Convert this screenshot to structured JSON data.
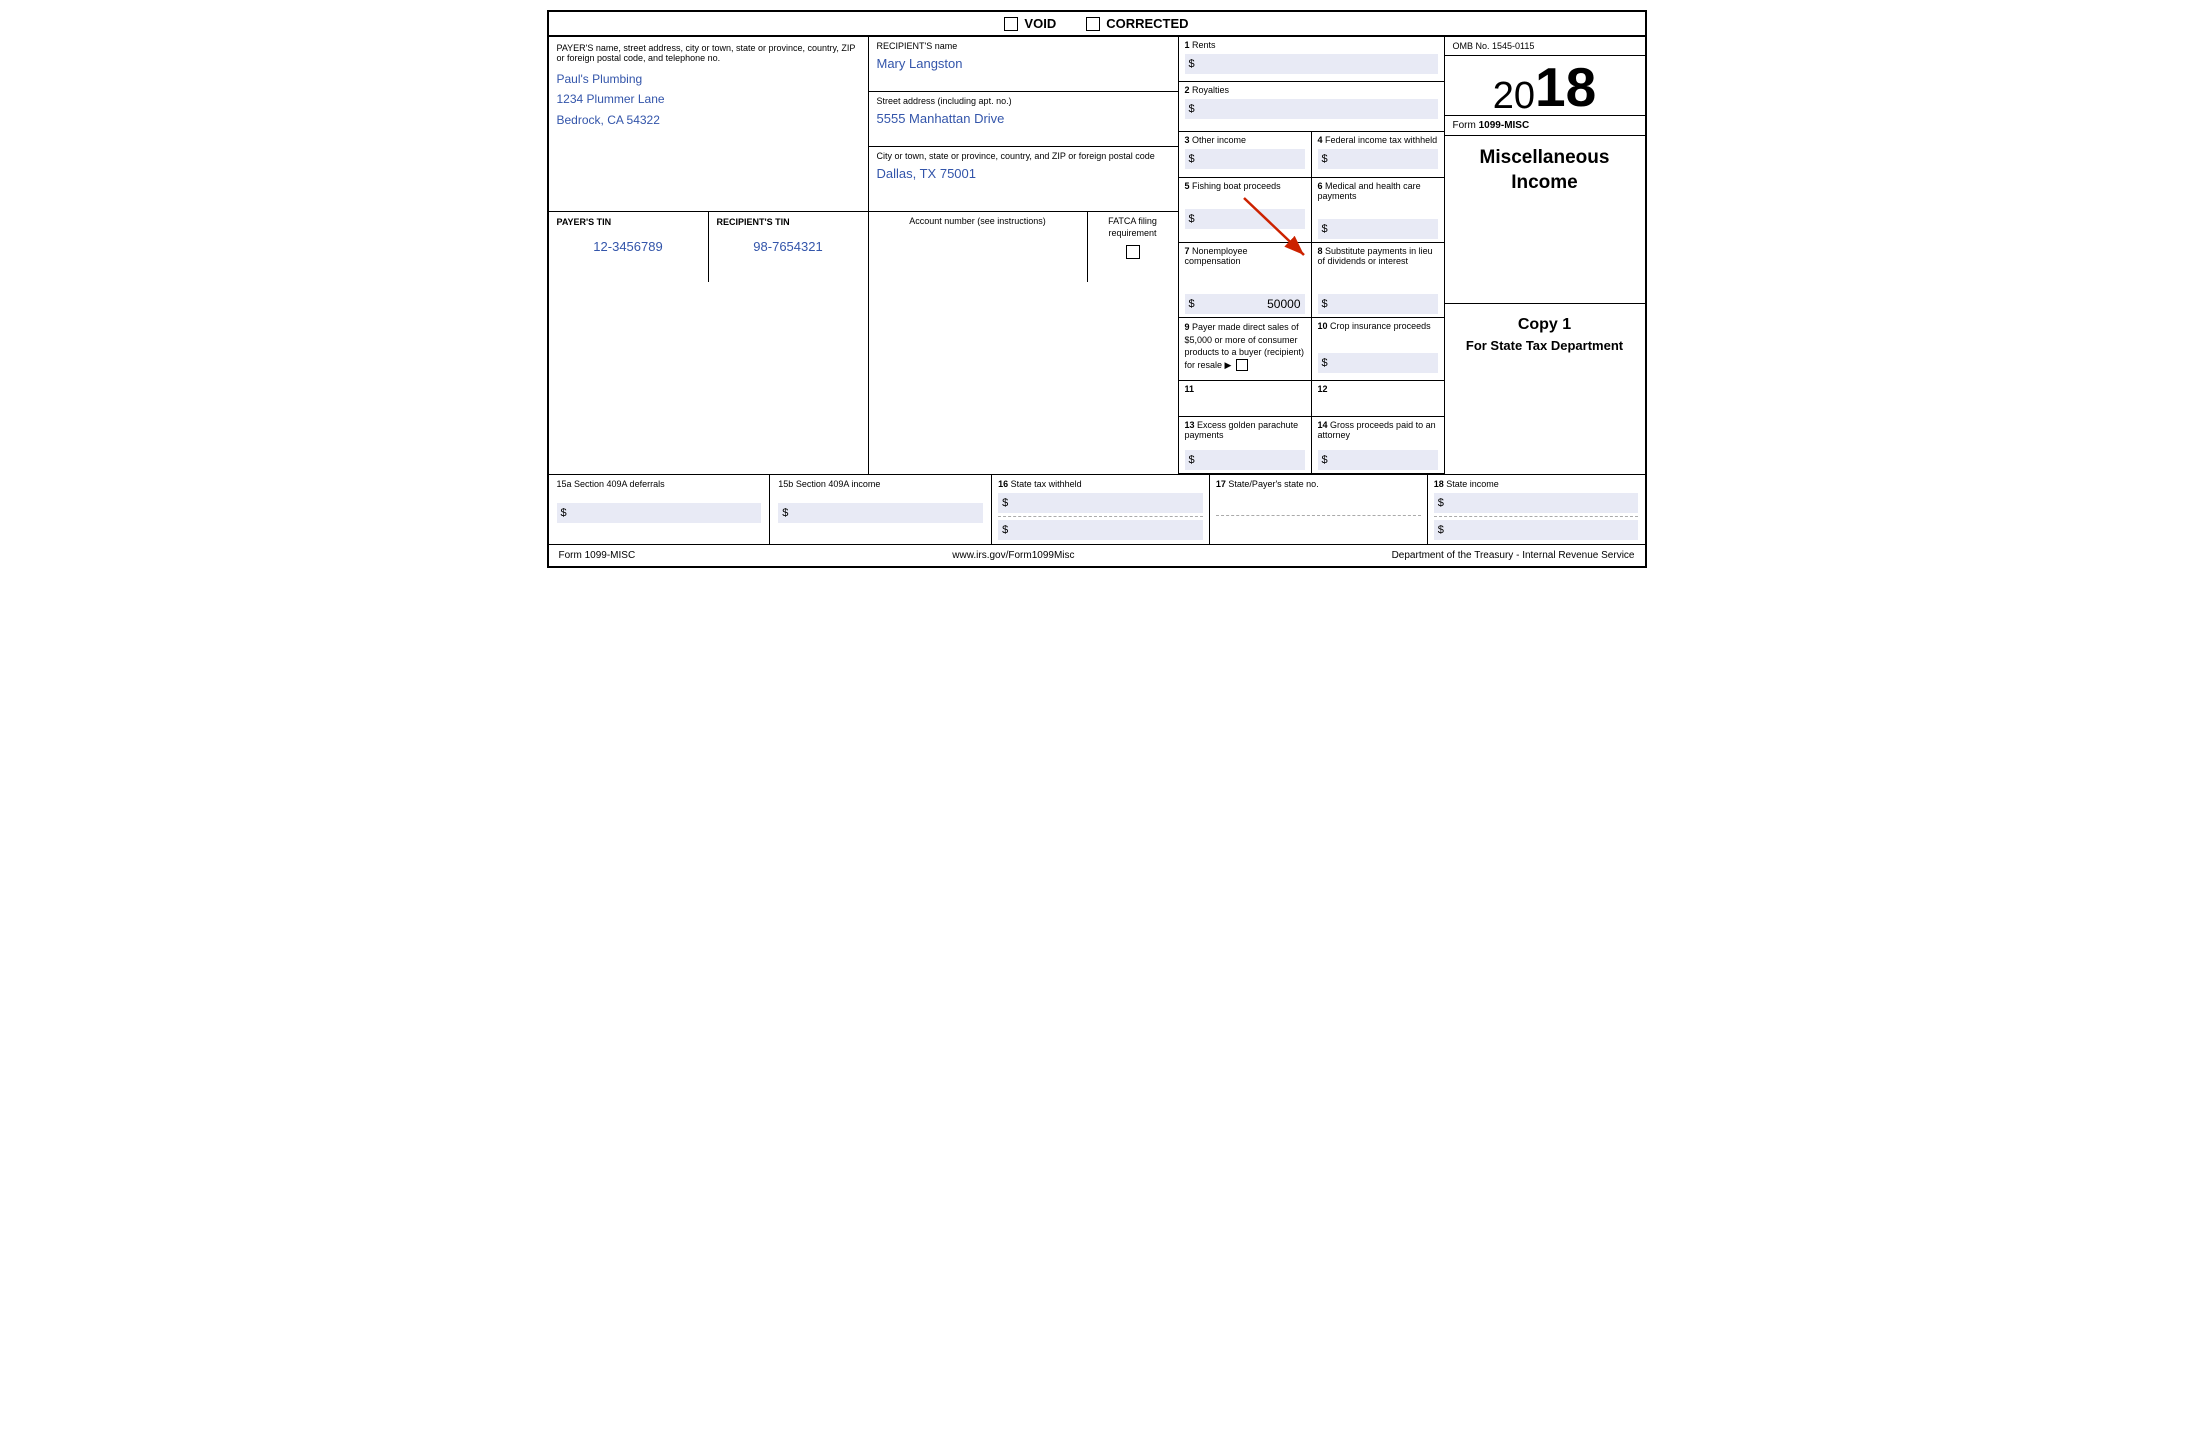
{
  "header": {
    "void_label": "VOID",
    "corrected_label": "CORRECTED"
  },
  "payer": {
    "field_label": "PAYER'S name, street address, city or town, state or province, country, ZIP or foreign postal code, and telephone no.",
    "name": "Paul's Plumbing",
    "address": "1234 Plummer Lane",
    "city_state_zip": "Bedrock, CA 54322"
  },
  "payer_tin": {
    "label": "PAYER'S TIN",
    "value": "12-3456789"
  },
  "recipient_tin": {
    "label": "RECIPIENT'S TIN",
    "value": "98-7654321"
  },
  "recipient": {
    "name_label": "RECIPIENT'S name",
    "name": "Mary Langston",
    "street_label": "Street address (including apt. no.)",
    "street": "5555 Manhattan Drive",
    "city_label": "City or town, state or province, country, and ZIP or foreign postal code",
    "city": "Dallas, TX 75001"
  },
  "account": {
    "label": "Account number (see instructions)",
    "fatca_label": "FATCA filing requirement"
  },
  "omb": {
    "number": "OMB No. 1545-0115",
    "year_prefix": "20",
    "year_suffix": "18",
    "form_label": "Form",
    "form_name": "1099-MISC"
  },
  "misc_income_title": "Miscellaneous Income",
  "copy": {
    "title": "Copy 1",
    "subtitle": "For State Tax Department"
  },
  "boxes": {
    "box1": {
      "num": "1",
      "label": "Rents",
      "dollar": "$",
      "value": ""
    },
    "box2": {
      "num": "2",
      "label": "Royalties",
      "dollar": "$",
      "value": ""
    },
    "box3": {
      "num": "3",
      "label": "Other income",
      "dollar": "$",
      "value": ""
    },
    "box4": {
      "num": "4",
      "label": "Federal income tax withheld",
      "dollar": "$",
      "value": ""
    },
    "box5": {
      "num": "5",
      "label": "Fishing boat proceeds",
      "dollar": "$",
      "value": ""
    },
    "box6": {
      "num": "6",
      "label": "Medical and health care payments",
      "dollar": "$",
      "value": ""
    },
    "box7": {
      "num": "7",
      "label": "Nonemployee compensation",
      "dollar": "$",
      "value": "50000"
    },
    "box8": {
      "num": "8",
      "label": "Substitute payments in lieu of dividends or interest",
      "dollar": "$",
      "value": ""
    },
    "box9": {
      "num": "9",
      "label": "Payer made direct sales of $5,000 or more of consumer products to a buyer (recipient) for resale ▶"
    },
    "box10": {
      "num": "10",
      "label": "Crop insurance proceeds",
      "dollar": "$",
      "value": ""
    },
    "box11": {
      "num": "11",
      "label": ""
    },
    "box12": {
      "num": "12",
      "label": ""
    },
    "box13": {
      "num": "13",
      "label": "Excess golden parachute payments",
      "dollar": "$",
      "value": ""
    },
    "box14": {
      "num": "14",
      "label": "Gross proceeds paid to an attorney",
      "dollar": "$",
      "value": ""
    },
    "box15a": {
      "label": "15a Section 409A deferrals",
      "dollar": "$",
      "value": ""
    },
    "box15b": {
      "label": "15b Section 409A income",
      "dollar": "$",
      "value": ""
    },
    "box16": {
      "num": "16",
      "label": "State tax withheld",
      "dollar": "$",
      "value": ""
    },
    "box17": {
      "num": "17",
      "label": "State/Payer's state no."
    },
    "box18": {
      "num": "18",
      "label": "State income",
      "dollar": "$",
      "value": ""
    }
  },
  "footer": {
    "form_label": "Form 1099-MISC",
    "website": "www.irs.gov/Form1099Misc",
    "dept": "Department of the Treasury - Internal Revenue Service"
  }
}
